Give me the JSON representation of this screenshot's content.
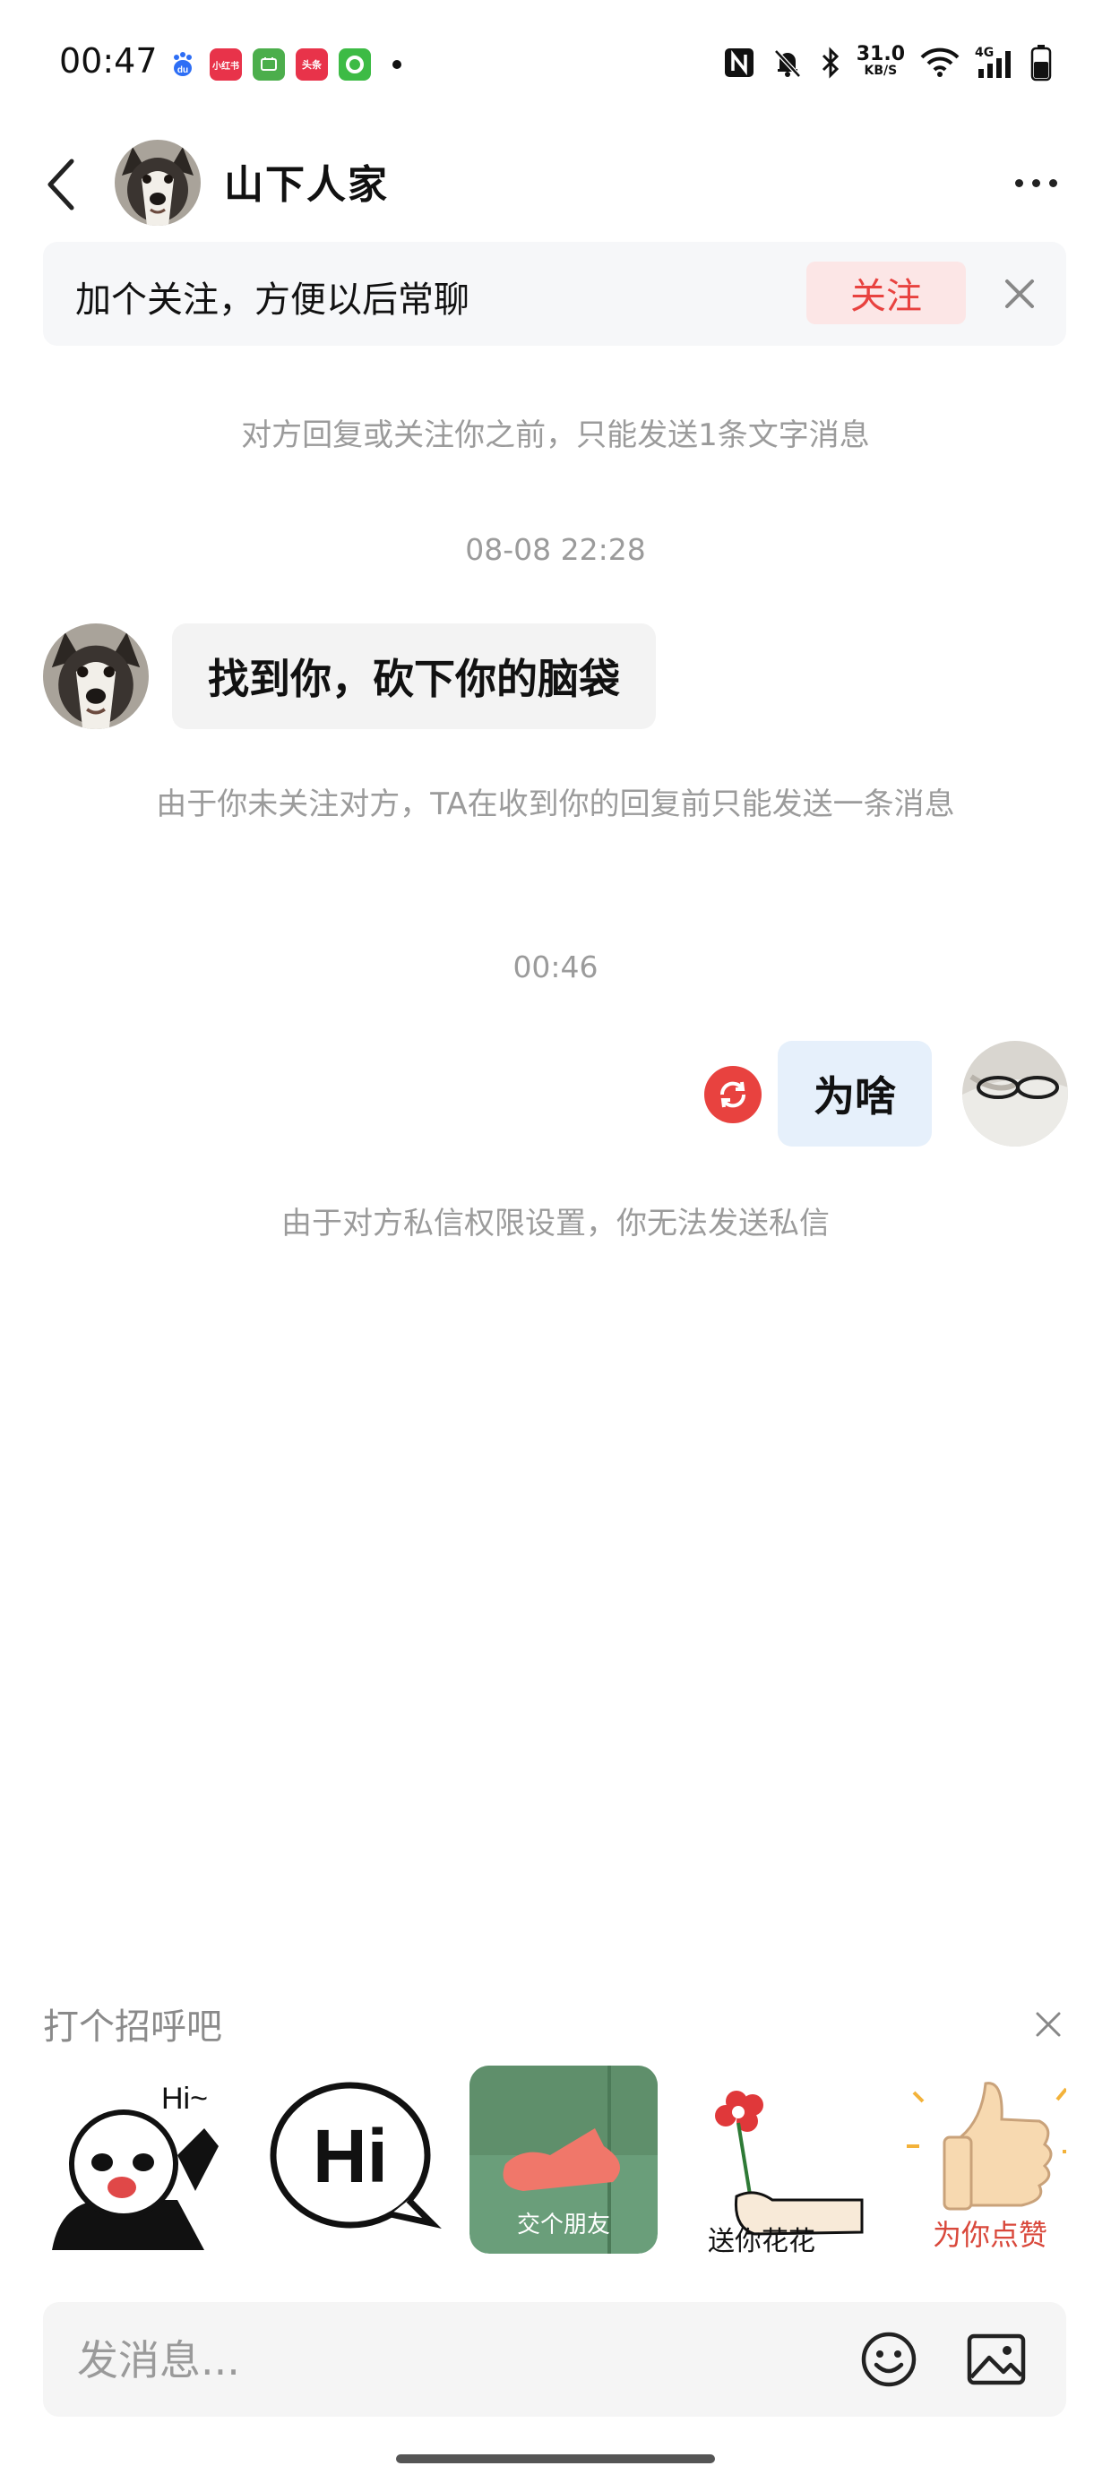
{
  "status_bar": {
    "time": "00:47",
    "net_speed_value": "31.0",
    "net_speed_unit": "KB/S",
    "network": "4G",
    "notification_apps": [
      {
        "name": "baidu-icon",
        "label": "du",
        "color": "#2d6ef5"
      },
      {
        "name": "xiaohongshu-icon",
        "label": "小红书",
        "color": "#e8334a"
      },
      {
        "name": "app-green-icon",
        "label": "",
        "color": "#4cae4c"
      },
      {
        "name": "toutiao-icon",
        "label": "头条",
        "color": "#e8334a"
      },
      {
        "name": "app-circle-icon",
        "label": "",
        "color": "#3dbb45"
      }
    ]
  },
  "header": {
    "title": "山下人家",
    "back_icon": "chevron-left-icon",
    "more_icon": "more-dots-icon"
  },
  "follow_banner": {
    "text": "加个关注，方便以后常聊",
    "button_label": "关注",
    "accent_color": "#e8423f"
  },
  "chat": {
    "notice_top": "对方回复或关注你之前，只能发送1条文字消息",
    "timestamp_1": "08-08 22:28",
    "incoming_message": "找到你，砍下你的脑袋",
    "notice_mid": "由于你未关注对方，TA在收到你的回复前只能发送一条消息",
    "timestamp_2": "00:46",
    "outgoing_message": "为啥",
    "notice_bottom": "由于对方私信权限设置，你无法发送私信"
  },
  "greeting_panel": {
    "title": "打个招呼吧",
    "stickers": [
      {
        "name": "sticker-panda-hi",
        "caption": "Hi~"
      },
      {
        "name": "sticker-hi-bubble",
        "caption": "Hi"
      },
      {
        "name": "sticker-make-friends",
        "caption": "交个朋友"
      },
      {
        "name": "sticker-send-flower",
        "caption": "送你花花"
      },
      {
        "name": "sticker-thumbs-up",
        "caption": "为你点赞"
      }
    ]
  },
  "input_bar": {
    "placeholder": "发消息..."
  }
}
